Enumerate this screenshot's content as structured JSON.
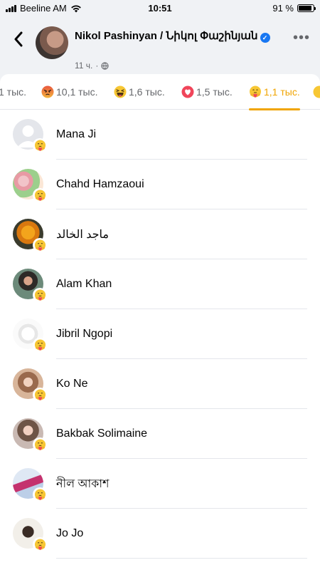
{
  "status_bar": {
    "carrier": "Beeline AM",
    "time": "10:51",
    "battery": "91 %",
    "battery_level": 0.91
  },
  "header": {
    "title": "Nikol Pashinyan / Նիկոլ Փաշինյան",
    "time_ago": "11 ч.",
    "dot": "·",
    "more_icon": "more-horizontal-icon",
    "back_icon": "chevron-left-icon"
  },
  "tabs": [
    {
      "label": "1 тыс.",
      "icon": "none"
    },
    {
      "label": "10,1 тыс.",
      "icon": "angry-reaction-icon"
    },
    {
      "label": "1,6 тыс.",
      "icon": "haha-reaction-icon"
    },
    {
      "label": "1,5 тыс.",
      "icon": "love-reaction-icon"
    },
    {
      "label": "1,1 тыс.",
      "icon": "care-reaction-icon",
      "active": true
    }
  ],
  "people": [
    {
      "name": "Mana Ji"
    },
    {
      "name": "Chahd Hamzaoui"
    },
    {
      "name": "ماجد الخالد"
    },
    {
      "name": "Alam Khan"
    },
    {
      "name": "Jibril Ngopi"
    },
    {
      "name": "Ko Ne"
    },
    {
      "name": "Bakbak Solimaine"
    },
    {
      "name": "নীল আকাশ"
    },
    {
      "name": "Jo Jo"
    }
  ],
  "colors": {
    "accent": "#f0a400",
    "muted": "#65676b",
    "verified": "#1877f2"
  }
}
